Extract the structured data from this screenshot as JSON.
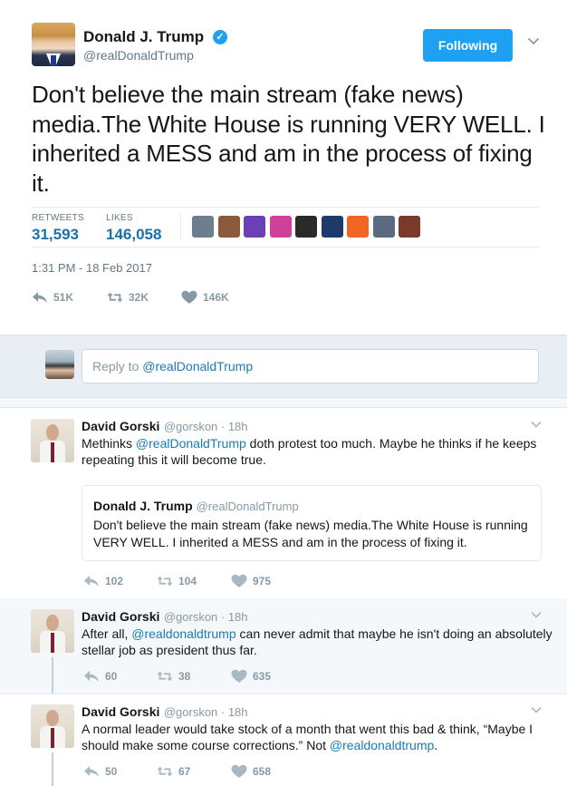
{
  "main_tweet": {
    "name": "Donald J. Trump",
    "handle": "@realDonaldTrump",
    "follow_label": "Following",
    "text": "Don't believe the main stream (fake news) media.The White House is running VERY WELL. I inherited a MESS and am in the process of fixing it.",
    "retweets_label": "RETWEETS",
    "retweets_value": "31,593",
    "likes_label": "LIKES",
    "likes_value": "146,058",
    "timestamp": "1:31 PM - 18 Feb 2017",
    "actions": {
      "reply": "51K",
      "retweet": "32K",
      "like": "146K"
    },
    "liker_colors": [
      "#6b7f8f",
      "#8a5a3a",
      "#6b3fb8",
      "#d0409a",
      "#2a2a2a",
      "#1d3b6a",
      "#f26522",
      "#5a6a80",
      "#7a3a2a"
    ]
  },
  "reply_box": {
    "prefix": "Reply to ",
    "mention": "@realDonaldTrump"
  },
  "replies": [
    {
      "name": "David Gorski",
      "handle": "@gorskon · 18h",
      "text_before": "Methinks ",
      "text_link": "@realDonaldTrump",
      "text_after": " doth protest too much. Maybe he thinks if he keeps repeating this it will become true.",
      "quote": {
        "name": "Donald J. Trump",
        "handle": "@realDonaldTrump",
        "text": "Don't believe the main stream (fake news) media.The White House is running VERY WELL. I inherited a MESS and am in the process of fixing it."
      },
      "actions": {
        "reply": "102",
        "retweet": "104",
        "like": "975"
      }
    },
    {
      "name": "David Gorski",
      "handle": "@gorskon · 18h",
      "text_before": "After all, ",
      "text_link": "@realdonaldtrump",
      "text_after": " can never admit that maybe he isn't doing an absolutely stellar job as president thus far.",
      "actions": {
        "reply": "60",
        "retweet": "38",
        "like": "635"
      }
    },
    {
      "name": "David Gorski",
      "handle": "@gorskon · 18h",
      "text_before": "A normal leader would take stock of a month that went this bad & think, “Maybe I should make some course corrections.” Not ",
      "text_link": "@realdonaldtrump",
      "text_after": ".",
      "actions": {
        "reply": "50",
        "retweet": "67",
        "like": "658"
      }
    }
  ]
}
